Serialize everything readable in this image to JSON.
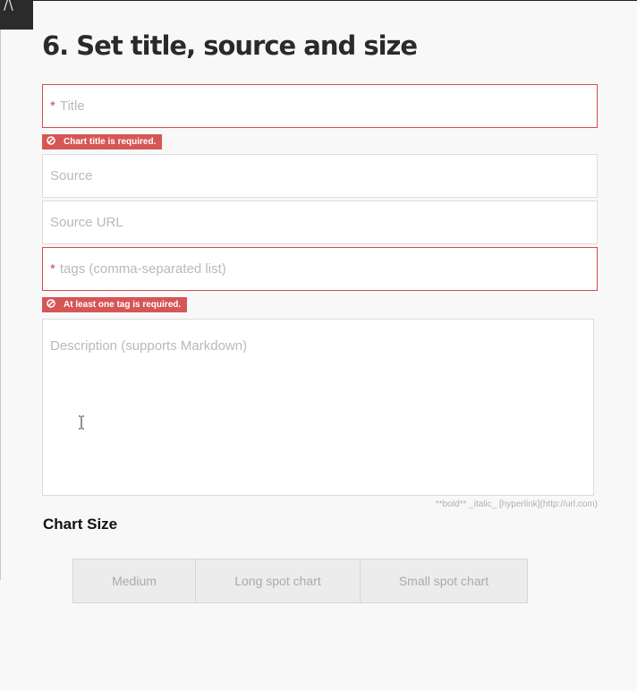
{
  "heading": "6. Set title, source and size",
  "form": {
    "title": {
      "required_mark": "*",
      "placeholder": "Title",
      "error": "Chart title is required."
    },
    "source": {
      "placeholder": "Source"
    },
    "source_url": {
      "placeholder": "Source URL"
    },
    "tags": {
      "required_mark": "*",
      "placeholder": "tags (comma-separated list)",
      "error": "At least one tag is required."
    },
    "description": {
      "placeholder": "Description (supports Markdown)"
    },
    "markdown_hint": "**bold** _italic_ [hyperlink](http://url.com)"
  },
  "chart_size": {
    "label": "Chart Size",
    "options": [
      "Medium",
      "Long spot chart",
      "Small spot chart"
    ]
  },
  "colors": {
    "error": "#d65656",
    "error_border": "#d34c4c",
    "background": "#f8f8f8"
  },
  "icons": {
    "error_icon": "ban-circle",
    "corner_icon": "chevron-up"
  }
}
